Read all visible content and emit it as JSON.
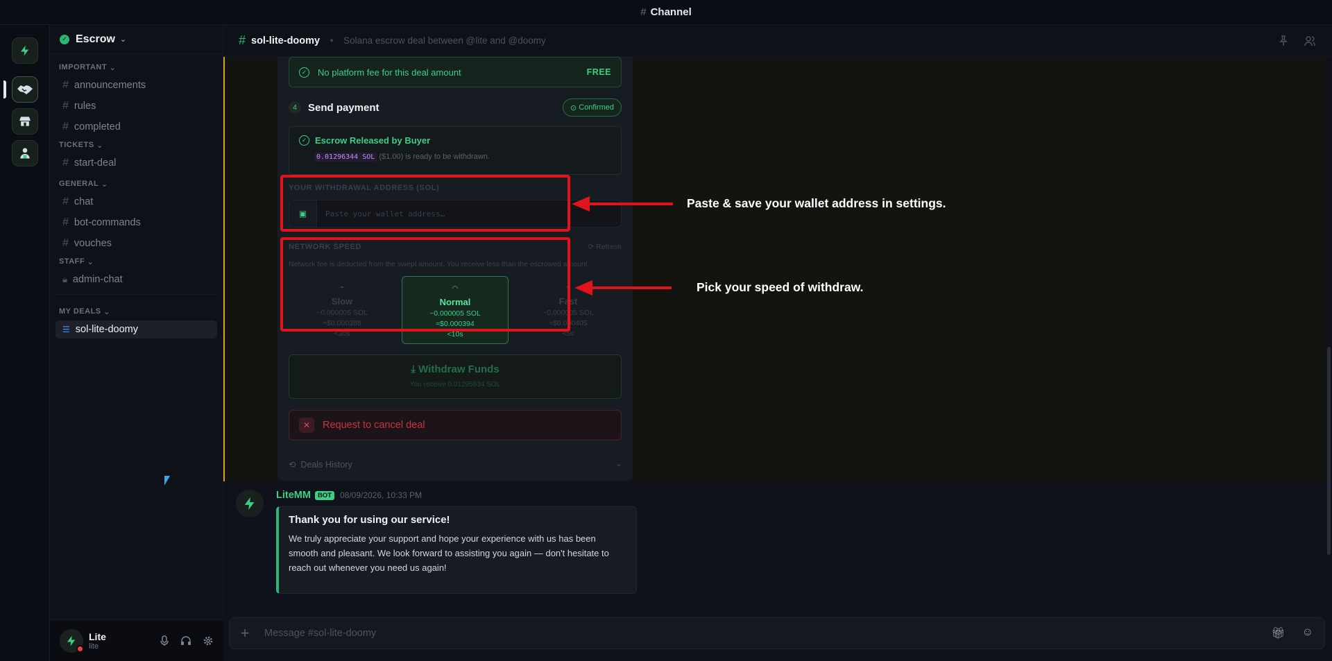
{
  "window": {
    "title": "Channel"
  },
  "server": {
    "name": "Escrow"
  },
  "sidebar": {
    "categories": [
      {
        "name": "IMPORTANT",
        "channels": [
          "announcements",
          "rules",
          "completed"
        ]
      },
      {
        "name": "TICKETS",
        "channels": [
          "start-deal"
        ]
      },
      {
        "name": "GENERAL",
        "channels": [
          "chat",
          "bot-commands",
          "vouches"
        ]
      },
      {
        "name": "STAFF",
        "channels": [
          "admin-chat"
        ]
      },
      {
        "name": "MY DEALS",
        "channels": [
          "sol-lite-doomy"
        ]
      }
    ]
  },
  "user": {
    "name": "Lite",
    "tag": "lite"
  },
  "channel": {
    "name": "sol-lite-doomy",
    "topic": "Solana escrow deal between @lite and @doomy"
  },
  "deal": {
    "fee_text": "No platform fee for this deal amount",
    "fee_badge": "FREE",
    "step_num": "4",
    "step_title": "Send payment",
    "step_status": "Confirmed",
    "release_title": "Escrow Released by Buyer",
    "release_amount": "0.01296344",
    "release_unit": "SOL",
    "release_rest": "($1.00) is ready to be withdrawn.",
    "withdraw_label": "YOUR WITHDRAWAL ADDRESS (SOL)",
    "withdraw_placeholder": "Paste your wallet address…",
    "speed_label": "NETWORK SPEED",
    "refresh_label": "Refresh",
    "speed_note": "Network fee is deducted from the swept amount. You receive less than the escrowed amount.",
    "speeds": [
      {
        "name": "Slow",
        "sol": "~0.000005 SOL",
        "usd": "≈$0.000388",
        "time": "<30s"
      },
      {
        "name": "Normal",
        "sol": "~0.000005 SOL",
        "usd": "≈$0.000394",
        "time": "<10s"
      },
      {
        "name": "Fast",
        "sol": "~0.000005 SOL",
        "usd": "≈$0.000405",
        "time": "<5s"
      }
    ],
    "withdraw_button": "Withdraw Funds",
    "withdraw_receive": "You receive 0.01295834 SOL",
    "cancel_label": "Request to cancel deal",
    "history_label": "Deals History"
  },
  "annotations": {
    "wallet": "Paste & save your wallet address in settings.",
    "speed": "Pick your speed of withdraw."
  },
  "message": {
    "author": "LiteMM",
    "badge": "BOT",
    "timestamp": "08/09/2026, 10:33 PM",
    "embed_title": "Thank you for using our service!",
    "embed_body": "We truly appreciate your support and hope your experience with us has been smooth and pleasant. We look forward to assisting you again — don't hesitate to reach out whenever you need us again!"
  },
  "composer": {
    "placeholder": "Message #sol-lite-doomy"
  },
  "colors": {
    "accent": "#3ecf85",
    "annotation_red": "#e1141b",
    "highlight_border": "#d9a21a"
  }
}
